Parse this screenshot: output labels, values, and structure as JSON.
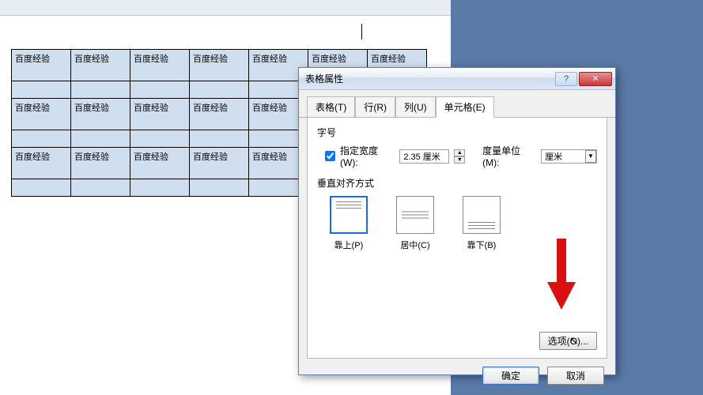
{
  "document": {
    "cell_text": "百度经验",
    "rows": 3,
    "cols": 7
  },
  "dialog": {
    "title": "表格属性",
    "help_label": "?",
    "close_label": "✕",
    "tabs": [
      {
        "label": "表格(T)",
        "key": "T"
      },
      {
        "label": "行(R)",
        "key": "R"
      },
      {
        "label": "列(U)",
        "key": "U"
      },
      {
        "label": "单元格(E)",
        "key": "E"
      }
    ],
    "active_tab": 3,
    "cell": {
      "size_group": "字号",
      "width_check_label": "指定宽度(W):",
      "width_checked": true,
      "width_value": "2.35 厘米",
      "unit_label": "度量单位(M):",
      "unit_value": "厘米",
      "valign_group": "垂直对齐方式",
      "valign": [
        {
          "label": "靠上(P)"
        },
        {
          "label": "居中(C)"
        },
        {
          "label": "靠下(B)"
        }
      ],
      "valign_selected": 0,
      "options_btn": "选项(O)..."
    },
    "ok_btn": "确定",
    "cancel_btn": "取消"
  }
}
